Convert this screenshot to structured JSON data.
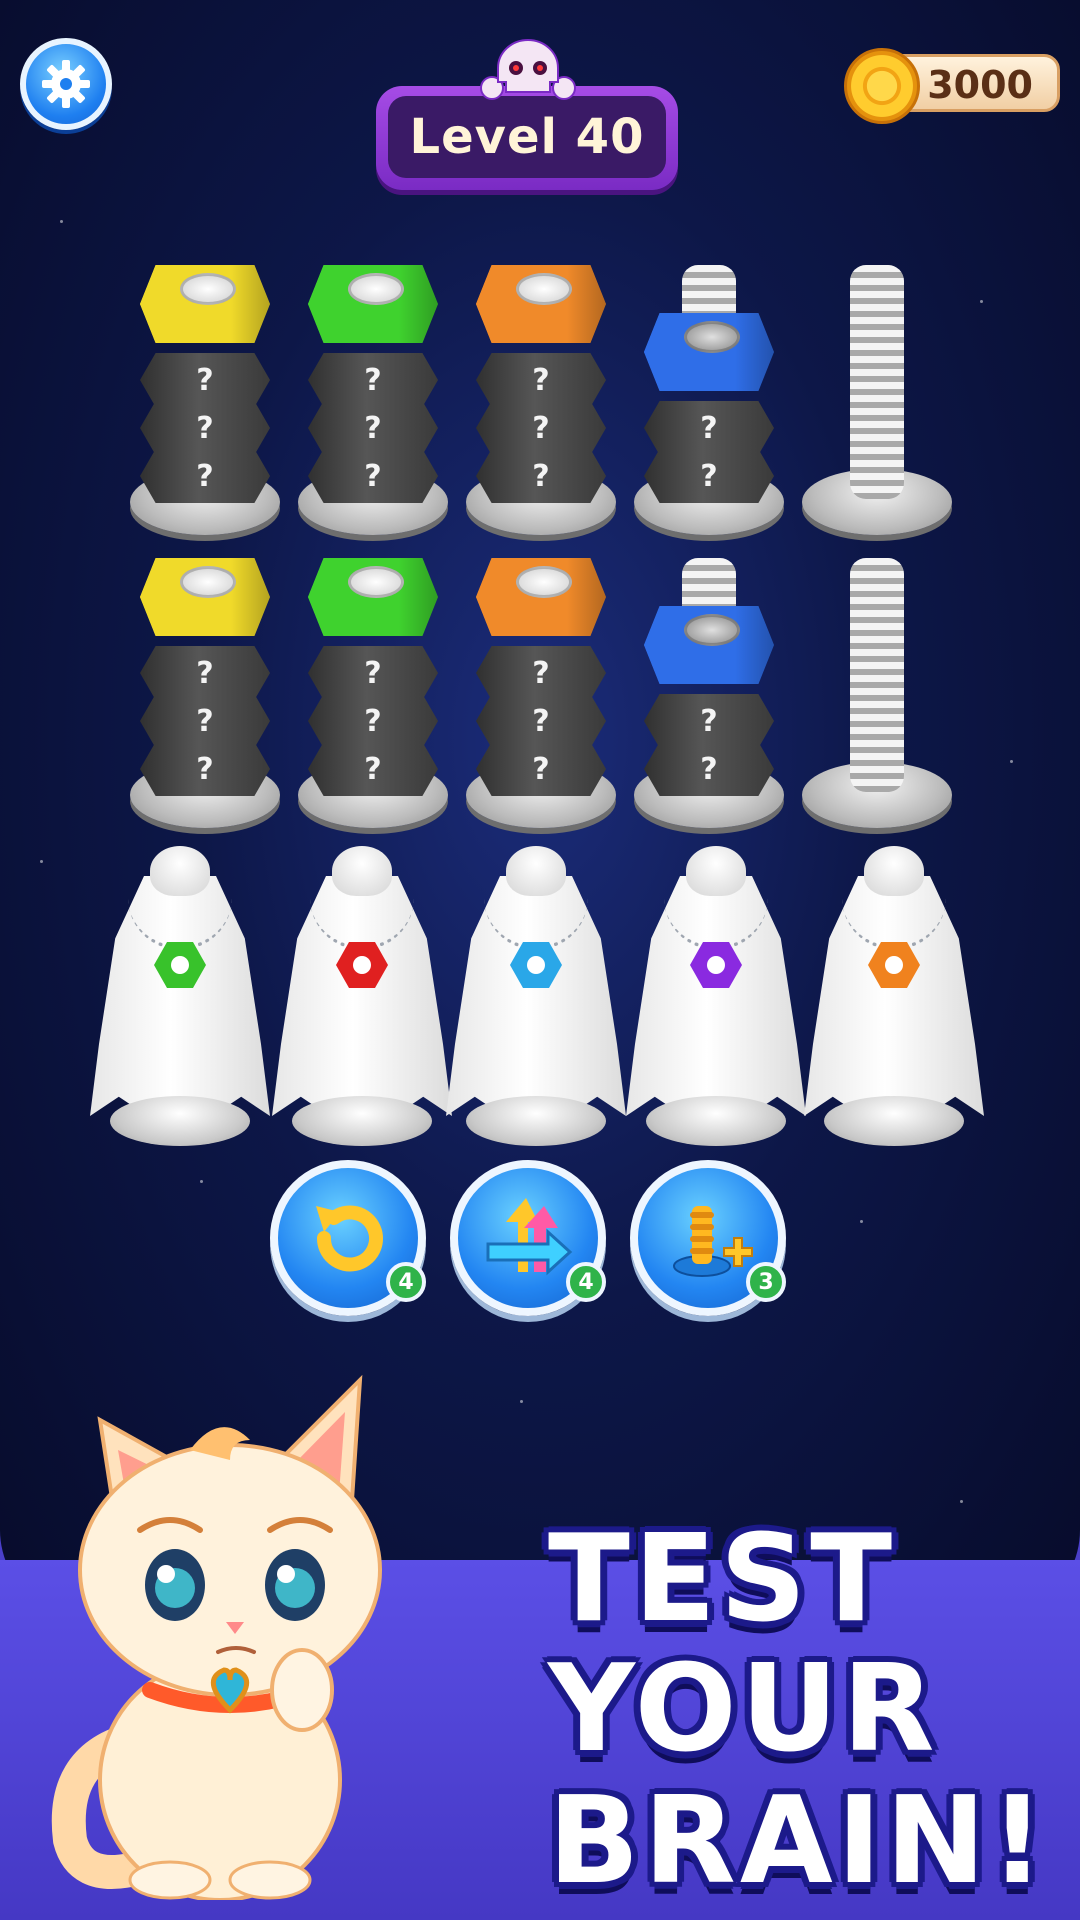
{
  "level": {
    "label": "Level 40"
  },
  "coins": {
    "value": "3000"
  },
  "board": {
    "bolt_rows": [
      [
        {
          "top_color": "#f0da2a",
          "hidden": 3
        },
        {
          "top_color": "#3fd22e",
          "hidden": 3
        },
        {
          "top_color": "#f08a2a",
          "hidden": 3
        },
        {
          "top_color": "#2f6ee8",
          "hidden": 2,
          "screw_exposed": true
        },
        {
          "empty": true
        }
      ],
      [
        {
          "top_color": "#f0da2a",
          "hidden": 3
        },
        {
          "top_color": "#3fd22e",
          "hidden": 3
        },
        {
          "top_color": "#f08a2a",
          "hidden": 3
        },
        {
          "top_color": "#2f6ee8",
          "hidden": 2,
          "screw_exposed": true
        },
        {
          "empty": true
        }
      ]
    ],
    "hidden_mark": "?",
    "ghost_colors": [
      "#38c22b",
      "#e02020",
      "#2aa7e8",
      "#8a2ae0",
      "#f0821e"
    ]
  },
  "powerups": [
    {
      "icon": "undo-icon",
      "count": "4"
    },
    {
      "icon": "shuffle-icon",
      "count": "4"
    },
    {
      "icon": "add-screw-icon",
      "count": "3"
    }
  ],
  "promo": {
    "line1": "TEST",
    "line2": "YOUR",
    "line3": "BRAIN!"
  }
}
